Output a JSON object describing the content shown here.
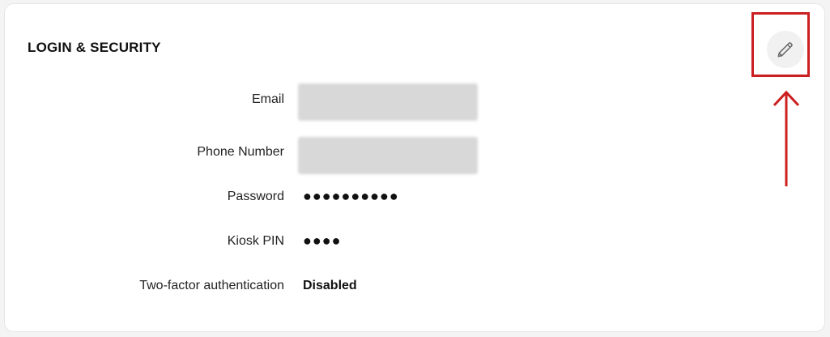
{
  "section": {
    "title": "LOGIN & SECURITY"
  },
  "fields": {
    "email": {
      "label": "Email"
    },
    "phone": {
      "label": "Phone Number"
    },
    "password": {
      "label": "Password",
      "value": "●●●●●●●●●●"
    },
    "kiosk_pin": {
      "label": "Kiosk PIN",
      "value": "●●●●"
    },
    "two_factor": {
      "label": "Two-factor authentication",
      "value": "Disabled"
    }
  },
  "icons": {
    "edit": "pencil-icon"
  },
  "colors": {
    "highlight": "#cc1f1f",
    "redaction": "#d8d8d8"
  }
}
